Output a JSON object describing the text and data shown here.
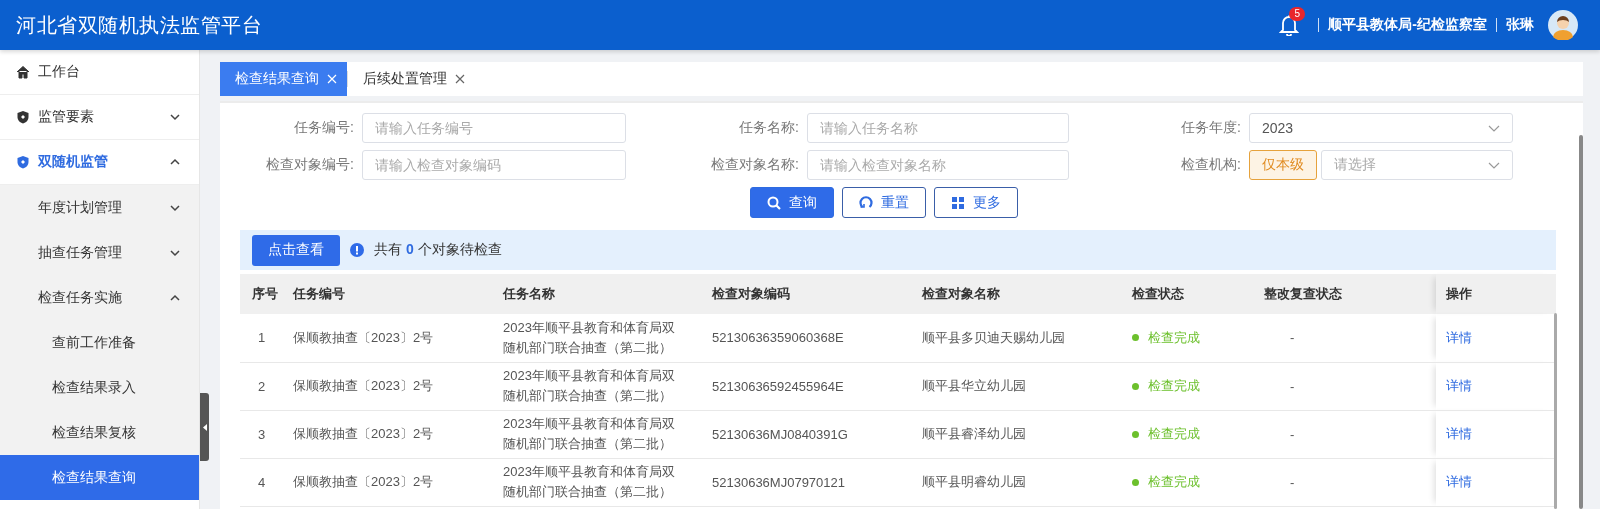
{
  "header": {
    "title": "河北省双随机执法监管平台",
    "notification_count": "5",
    "organization": "顺平县教体局-纪检监察室",
    "user": "张琳"
  },
  "sidebar": {
    "items": [
      {
        "label": "工作台",
        "selected": false
      },
      {
        "label": "监管要素",
        "expanded": false,
        "selected": false
      },
      {
        "label": "双随机监管",
        "expanded": true,
        "selected": false,
        "children": [
          {
            "label": "年度计划管理",
            "expanded": false,
            "selected": false
          },
          {
            "label": "抽查任务管理",
            "expanded": false,
            "selected": false
          },
          {
            "label": "检查任务实施",
            "expanded": true,
            "selected": false,
            "children": [
              {
                "label": "查前工作准备",
                "selected": false
              },
              {
                "label": "检查结果录入",
                "selected": false
              },
              {
                "label": "检查结果复核",
                "selected": false
              },
              {
                "label": "检查结果查询",
                "selected": true
              }
            ]
          }
        ]
      }
    ]
  },
  "tabs": [
    {
      "label": "检查结果查询",
      "selected": true
    },
    {
      "label": "后续处置管理",
      "selected": false
    }
  ],
  "filters": [
    {
      "label": "任务编号:",
      "kind": "text",
      "placeholder": "请输入任务编号"
    },
    {
      "label": "任务名称:",
      "kind": "text",
      "placeholder": "请输入任务名称"
    },
    {
      "label": "任务年度:",
      "kind": "select",
      "value": "2023"
    },
    {
      "label": "检查对象编号:",
      "kind": "text",
      "placeholder": "请输入检查对象编码"
    },
    {
      "label": "检查对象名称:",
      "kind": "text",
      "placeholder": "请输入检查对象名称"
    },
    {
      "label": "检查机构:",
      "kind": "select",
      "tag": "仅本级",
      "placeholder": "请选择"
    }
  ],
  "buttons": [
    {
      "label": "查询",
      "kind": "primary"
    },
    {
      "label": "重置",
      "kind": "outline"
    },
    {
      "label": "更多",
      "kind": "outline"
    }
  ],
  "notice": {
    "button": "点击查看",
    "text": "共有 **0** 个对象待检查"
  },
  "table": {
    "columns": [
      "序号",
      "任务编号",
      "任务名称",
      "检查对象编码",
      "检查对象名称",
      "检查状态",
      "整改复查状态",
      "操作"
    ],
    "rows": [
      {
        "index": "1",
        "task_no": "保顺教抽查〔2023〕2号",
        "task_name": "2023年顺平县教育和体育局双随机部门联合抽查（第二批）",
        "object_code": "52130636359060368E",
        "object_name": "顺平县多贝迪天赐幼儿园",
        "check_status": "检查完成",
        "color": "#6cc02c",
        "recheck_status": "-",
        "action": "详情"
      },
      {
        "index": "2",
        "task_no": "保顺教抽查〔2023〕2号",
        "task_name": "2023年顺平县教育和体育局双随机部门联合抽查（第二批）",
        "object_code": "52130636592455964E",
        "object_name": "顺平县华立幼儿园",
        "check_status": "检查完成",
        "color": "#6cc02c",
        "recheck_status": "-",
        "action": "详情"
      },
      {
        "index": "3",
        "task_no": "保顺教抽查〔2023〕2号",
        "task_name": "2023年顺平县教育和体育局双随机部门联合抽查（第二批）",
        "object_code": "52130636MJ0840391G",
        "object_name": "顺平县睿泽幼儿园",
        "check_status": "检查完成",
        "color": "#6cc02c",
        "recheck_status": "-",
        "action": "详情"
      },
      {
        "index": "4",
        "task_no": "保顺教抽查〔2023〕2号",
        "task_name": "2023年顺平县教育和体育局双随机部门联合抽查（第二批）",
        "object_code": "52130636MJ07970121",
        "object_name": "顺平县明睿幼儿园",
        "check_status": "检查完成",
        "color": "#6cc02c",
        "recheck_status": "-",
        "action": "详情"
      }
    ]
  }
}
